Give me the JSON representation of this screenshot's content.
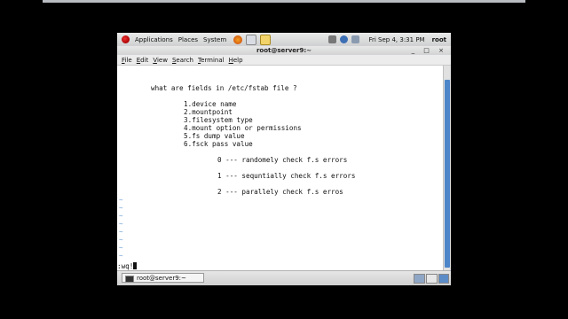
{
  "panel": {
    "applications": "Applications",
    "places": "Places",
    "system": "System",
    "clock": "Fri Sep  4,  3:31 PM",
    "user": "root"
  },
  "window": {
    "title": "root@server9:~",
    "controls": "_ □ ×"
  },
  "menu": [
    "File",
    "Edit",
    "View",
    "Search",
    "Terminal",
    "Help"
  ],
  "terminal": {
    "question": "what are fields in /etc/fstab file ?",
    "fields": [
      "1.device name",
      "2.mountpoint",
      "3.filesystem type",
      "4.mount option or permissions",
      "5.fs dump value",
      "6.fsck pass value"
    ],
    "fsck_values": [
      "0 --- randomely check f.s errors",
      "1 --- sequntially check f.s errors",
      "2 --- parallely check f.s erros"
    ],
    "tilde": "~",
    "command": ":wq!"
  },
  "taskbar": {
    "task_label": "root@server9:~"
  },
  "colors": {
    "scrollbar": "#4d86c9",
    "tilde": "#6c9ed6"
  }
}
